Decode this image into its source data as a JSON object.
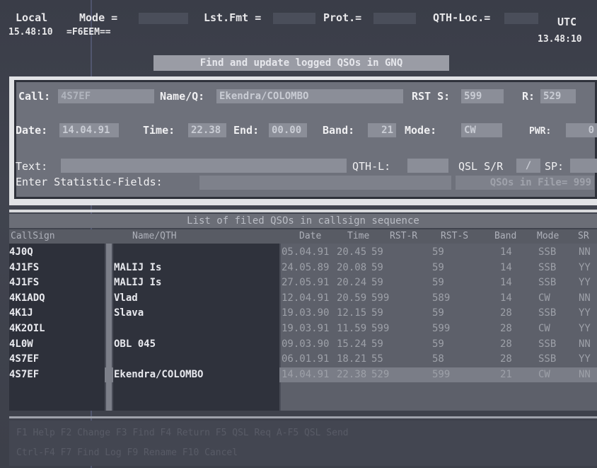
{
  "header": {
    "mode_label": "Local",
    "mode_eq": "Mode =",
    "lstfmt": "Lst.Fmt =",
    "prot": "Prot.=",
    "qthloc": "QTH-Loc.=",
    "utc": "UTC",
    "local_time": "15.48:10",
    "callsign": "=F6EEM==",
    "utc_time": "13.48:10"
  },
  "title": "Find and update logged QSOs in GNQ",
  "form": {
    "call_label": "Call:",
    "call_value": "4S7EF",
    "name_label": "Name/Q:",
    "name_value": "Ekendra/COLOMBO",
    "rsts_label": "RST S:",
    "rsts_value": "599",
    "r_label": "R:",
    "r_value": "529",
    "date_label": "Date:",
    "date_value": "14.04.91",
    "time_label": "Time:",
    "time_value": "22.38",
    "end_label": "End:",
    "end_value": "00.00",
    "band_label": "Band:",
    "band_value": "21",
    "mode_label": "Mode:",
    "mode_value": "CW",
    "pwr_label": "PWR:",
    "pwr_value": "0",
    "text_label": "Text:",
    "qthl_label": "QTH-L:",
    "qsl_label": "QSL S/R",
    "qsl_value": "/",
    "sp_label": "SP:",
    "stat_label": "Enter Statistic-Fields:",
    "qsos_in_file": "QSOs in File= 999"
  },
  "list": {
    "title": "List of filed QSOs in callsign sequence",
    "columns": [
      "CallSign",
      "Name/QTH",
      "Date",
      "Time",
      "RST-R",
      "RST-S",
      "Band",
      "Mode",
      "SR"
    ],
    "rows": [
      {
        "call": "4J0Q",
        "name": "",
        "date": "05.04.91",
        "time": "20.45",
        "rstr": "59",
        "rsts": "59",
        "band": "14",
        "mode": "SSB",
        "sr": "NN"
      },
      {
        "call": "4J1FS",
        "name": "MALIJ Is",
        "date": "24.05.89",
        "time": "20.08",
        "rstr": "59",
        "rsts": "59",
        "band": "14",
        "mode": "SSB",
        "sr": "YY"
      },
      {
        "call": "4J1FS",
        "name": "MALIJ Is",
        "date": "27.05.91",
        "time": "20.24",
        "rstr": "59",
        "rsts": "59",
        "band": "14",
        "mode": "SSB",
        "sr": "YY"
      },
      {
        "call": "4K1ADQ",
        "name": "Vlad",
        "date": "12.04.91",
        "time": "20.59",
        "rstr": "599",
        "rsts": "589",
        "band": "14",
        "mode": "CW",
        "sr": "NN"
      },
      {
        "call": "4K1J",
        "name": "Slava",
        "date": "19.03.90",
        "time": "12.15",
        "rstr": "59",
        "rsts": "59",
        "band": "28",
        "mode": "SSB",
        "sr": "YY"
      },
      {
        "call": "4K2OIL",
        "name": "",
        "date": "19.03.91",
        "time": "11.59",
        "rstr": "599",
        "rsts": "599",
        "band": "28",
        "mode": "CW",
        "sr": "YY"
      },
      {
        "call": "4L0W",
        "name": "OBL 045",
        "date": "09.03.90",
        "time": "15.24",
        "rstr": "59",
        "rsts": "59",
        "band": "28",
        "mode": "SSB",
        "sr": "NN"
      },
      {
        "call": "4S7EF",
        "name": "",
        "date": "06.01.91",
        "time": "18.21",
        "rstr": "55",
        "rsts": "58",
        "band": "28",
        "mode": "SSB",
        "sr": "YY"
      },
      {
        "call": "4S7EF",
        "name": "Ekendra/COLOMBO",
        "date": "14.04.91",
        "time": "22.38",
        "rstr": "529",
        "rsts": "599",
        "band": "21",
        "mode": "CW",
        "sr": "NN"
      }
    ]
  },
  "fkeys": {
    "line1": "F1 Help  F2 Change  F3 Find  F4 Return  F5 QSL Req  A-F5 QSL Send",
    "line2": "Ctrl-F4  F7       Find Log    F9 Rename  F10 Cancel"
  },
  "colors": {
    "background": "#3b3f4a",
    "form_panel": "#6e717b",
    "field": "#8b8e98",
    "highlight_row": "#7a7d87"
  }
}
